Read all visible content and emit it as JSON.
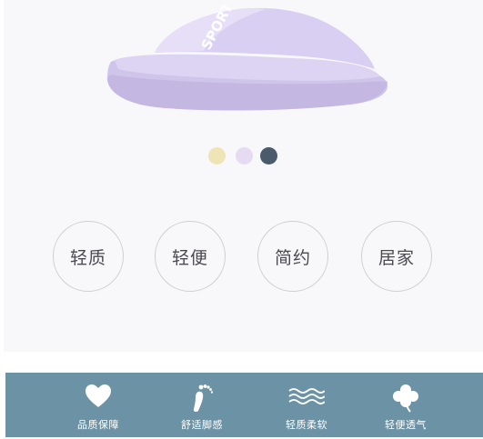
{
  "product": {
    "image": "slide-slipper",
    "print_text": "SPORT",
    "colors": [
      "#efe4b6",
      "#e5dcf4",
      "#4b5b6c"
    ]
  },
  "features": [
    "轻质",
    "轻便",
    "简约",
    "居家"
  ],
  "perks": [
    {
      "label": "品质保障",
      "icon": "heart-icon"
    },
    {
      "label": "舒适脚感",
      "icon": "foot-icon"
    },
    {
      "label": "轻质柔软",
      "icon": "wave-icon"
    },
    {
      "label": "轻便透气",
      "icon": "clover-icon"
    }
  ]
}
